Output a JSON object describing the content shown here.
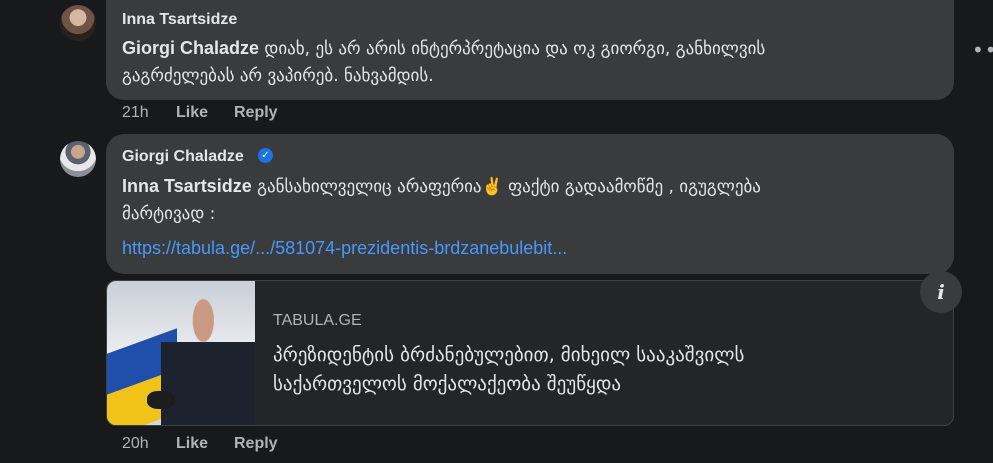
{
  "comments": [
    {
      "author": "Inna Tsartsidze",
      "mention": "Giorgi Chaladze",
      "line1_rest": " დიახ, ეს არ არის ინტერპრეტაცია და ოკ გიორგი, განხილვის",
      "line2": "გაგრძელებას არ ვაპირებ. ნახვამდის.",
      "time": "21h",
      "like_label": "Like",
      "reply_label": "Reply"
    },
    {
      "author": "Giorgi Chaladze",
      "verified_glyph": "✓",
      "mention": "Inna Tsartsidze",
      "line1_rest": " განსახილველიც არაფერია✌️ ფაქტი გადაამოწმე , იგუგლება",
      "line2": "მარტივად :",
      "link": "https://tabula.ge/.../581074-prezidentis-brdzanebulebit...",
      "time": "20h",
      "like_label": "Like",
      "reply_label": "Reply"
    }
  ],
  "preview": {
    "domain": "TABULA.GE",
    "headline_line1": "პრეზიდენტის ბრძანებულებით, მიხეილ სააკაშვილს",
    "headline_line2": "საქართველოს მოქალაქეობა შეუწყდა"
  },
  "more_options": "•••",
  "info_glyph": "i",
  "colors": {
    "background": "#18191a",
    "bubble": "#3a3b3c",
    "link": "#4599ff",
    "verified": "#1b74e4",
    "secondary_text": "#b0b3b8"
  },
  "icons": [
    "verified-badge-icon",
    "more-options-icon",
    "info-icon"
  ]
}
